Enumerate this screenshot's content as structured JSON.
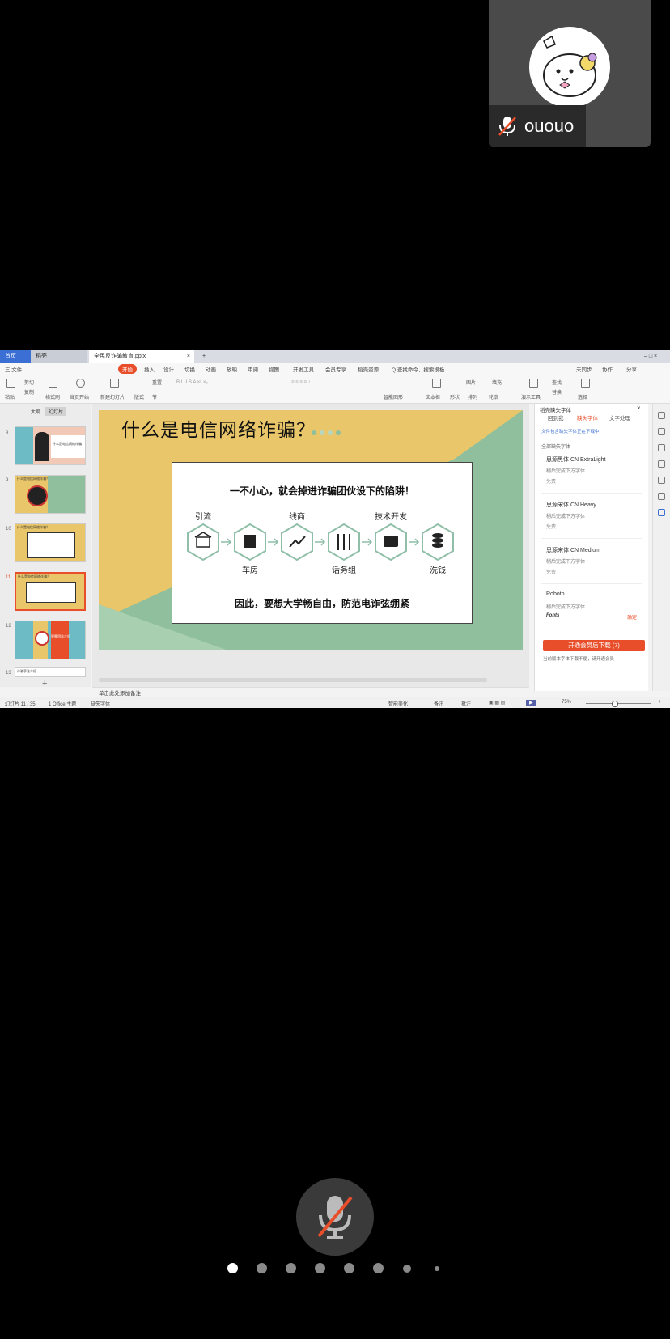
{
  "participant": {
    "name": "ououo"
  },
  "window": {
    "tabs": [
      {
        "label": "首页"
      },
      {
        "label": "稻壳"
      },
      {
        "label": "全民反诈骗教育.pptx"
      }
    ],
    "menus": [
      "三 文件",
      "开始",
      "插入",
      "设计",
      "切换",
      "动画",
      "放映",
      "审阅",
      "视图",
      "开发工具",
      "会员专享",
      "稻壳资源",
      "Q 查找命令、搜索模板"
    ],
    "menu_right": [
      "未同步",
      "协作",
      "分享"
    ],
    "ribbon": {
      "paste": "粘贴",
      "cut": "剪切",
      "copy": "复制",
      "format_painter": "格式刷",
      "play": "当页开始",
      "new_slide": "新建幻灯片",
      "layout": "版式",
      "section": "节",
      "reset": "重置",
      "text_box": "文本框",
      "shape": "形状",
      "arrange": "排列",
      "outline": "轮廓",
      "find": "查找",
      "replace": "替换",
      "select": "选择",
      "img": "图片",
      "fill": "填充",
      "smart_art": "智能图形",
      "show_tools": "演示工具"
    }
  },
  "left_panel": {
    "tabs": [
      "大纲",
      "幻灯片"
    ],
    "thumbs": [
      {
        "num": "8",
        "caption": "什么是电信网络诈骗"
      },
      {
        "num": "9",
        "caption": "什么是电信网络诈骗？"
      },
      {
        "num": "10",
        "caption": "什么是电信网络诈骗？"
      },
      {
        "num": "11",
        "caption": "什么是电信网络诈骗？"
      },
      {
        "num": "12",
        "caption": "犯罪团伙介绍"
      },
      {
        "num": "13",
        "caption": "诈骗手法介绍"
      }
    ]
  },
  "slide": {
    "title": "什么是电信网络诈骗？",
    "headline": "一不小心，就会掉进诈骗团伙设下的陷阱！",
    "footer": "因此，要想大学畅自由，防范电诈弦绷紧",
    "steps": [
      {
        "label": "引流",
        "pos": "top",
        "icon": "shop-icon"
      },
      {
        "label": "车房",
        "pos": "bottom",
        "icon": "building-icon"
      },
      {
        "label": "线商",
        "pos": "top",
        "icon": "chart-up-icon"
      },
      {
        "label": "话务组",
        "pos": "bottom",
        "icon": "sliders-icon"
      },
      {
        "label": "技术开发",
        "pos": "top",
        "icon": "wallet-icon"
      },
      {
        "label": "洗钱",
        "pos": "bottom",
        "icon": "coins-icon"
      }
    ],
    "notes_placeholder": "单击此处添加备注"
  },
  "right_panel": {
    "title": "稻壳缺失字体",
    "tabs": [
      "回到我",
      "缺失字体",
      "文字处理"
    ],
    "link": "文件包含缺失字体正在下载中",
    "section": "全部缺失字体",
    "fonts": [
      {
        "name": "思源黑体 CN ExtraLight",
        "sub": "稍后完成下方字体",
        "tag": "免费"
      },
      {
        "name": "思源宋体 CN Heavy",
        "sub": "稍后完成下方字体",
        "tag": "免费"
      },
      {
        "name": "思源宋体 CN Medium",
        "sub": "稍后完成下方字体",
        "tag": "免费"
      },
      {
        "name": "Roboto",
        "sub": "稍后完成下方字体",
        "tag": "Fonts"
      }
    ],
    "font_action": "确定",
    "download_button": "开通会员后下载 (7)",
    "note": "当前版本字体下载不便，请开通会员"
  },
  "status_bar": {
    "slide_info": "幻灯片 11 / 35",
    "theme": "1 Office 主题",
    "missing_font": "缺失字体",
    "beautify": "智能美化",
    "notes": "备注",
    "comments": "批注",
    "zoom": "75%"
  },
  "colors": {
    "accent": "#e94e2a",
    "slide_yellow": "#e9c669",
    "slide_green": "#8fbf9c",
    "hex_stroke": "#8fbfa8"
  },
  "pager": {
    "count": 8,
    "active_index": 0
  }
}
